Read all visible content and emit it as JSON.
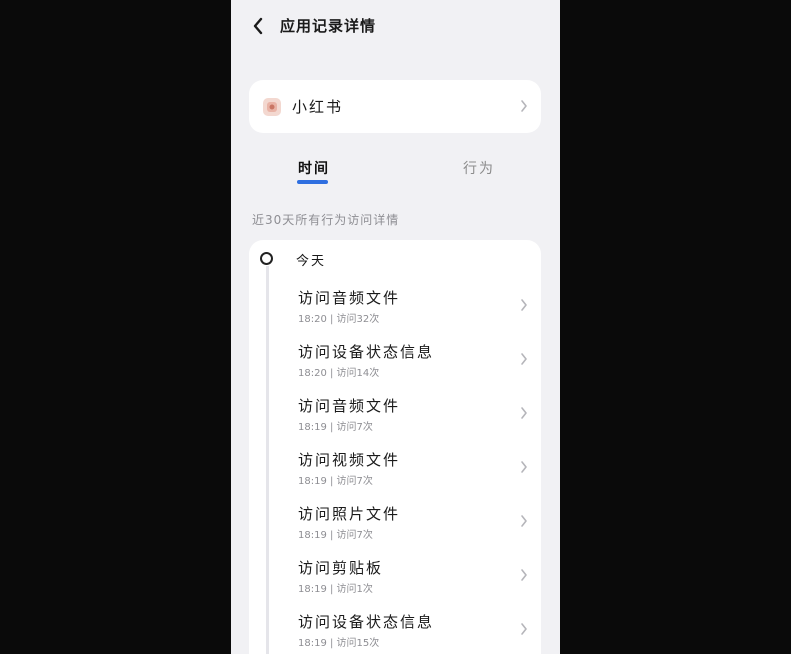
{
  "header": {
    "title": "应用记录详情"
  },
  "app": {
    "name": "小红书"
  },
  "tabs": [
    {
      "label": "时间",
      "active": true
    },
    {
      "label": "行为",
      "active": false
    }
  ],
  "section_label": "近30天所有行为访问详情",
  "timeline": {
    "group_label": "今天",
    "items": [
      {
        "title": "访问音频文件",
        "meta": "18:20 | 访问32次"
      },
      {
        "title": "访问设备状态信息",
        "meta": "18:20 | 访问14次"
      },
      {
        "title": "访问音频文件",
        "meta": "18:19 | 访问7次"
      },
      {
        "title": "访问视频文件",
        "meta": "18:19 | 访问7次"
      },
      {
        "title": "访问照片文件",
        "meta": "18:19 | 访问7次"
      },
      {
        "title": "访问剪贴板",
        "meta": "18:19 | 访问1次"
      },
      {
        "title": "访问设备状态信息",
        "meta": "18:19 | 访问15次"
      }
    ]
  },
  "colors": {
    "accent": "#2f6fe0",
    "background": "#f1f1f4",
    "card": "#ffffff"
  },
  "icons": {
    "back": "chevron-left-icon",
    "row": "chevron-right-icon",
    "app": "xiaohongshu-app-icon"
  }
}
